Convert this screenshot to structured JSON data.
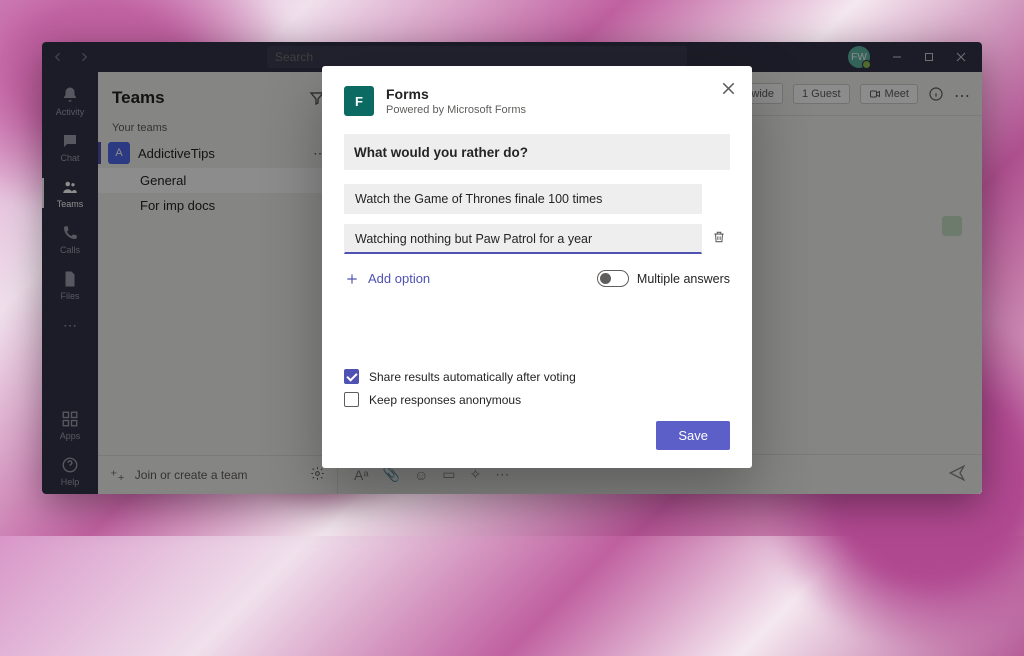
{
  "titlebar": {
    "search_placeholder": "Search",
    "avatar_initials": "FW"
  },
  "apprail": {
    "items": [
      {
        "label": "Activity",
        "icon": "bell"
      },
      {
        "label": "Chat",
        "icon": "chat"
      },
      {
        "label": "Teams",
        "icon": "teams"
      },
      {
        "label": "Calls",
        "icon": "phone"
      },
      {
        "label": "Files",
        "icon": "file"
      }
    ],
    "bottom": [
      {
        "label": "Apps",
        "icon": "apps"
      },
      {
        "label": "Help",
        "icon": "help"
      }
    ]
  },
  "teams_pane": {
    "heading": "Teams",
    "section_label": "Your teams",
    "team_name": "AddictiveTips",
    "team_initial": "A",
    "channels": [
      "General",
      "For imp docs"
    ],
    "footer_label": "Join or create a team"
  },
  "channel_header": {
    "tag1": "Org-wide",
    "tag2": "1 Guest",
    "meet_label": "Meet"
  },
  "modal": {
    "app_title": "Forms",
    "app_subtitle": "Powered by Microsoft Forms",
    "question": "What would you rather do?",
    "options": [
      "Watch the Game of Thrones finale 100 times",
      "Watching nothing but Paw Patrol for a year"
    ],
    "add_option_label": "Add option",
    "multiple_answers_label": "Multiple answers",
    "share_results_label": "Share results automatically after voting",
    "anonymous_label": "Keep responses anonymous",
    "save_label": "Save"
  }
}
